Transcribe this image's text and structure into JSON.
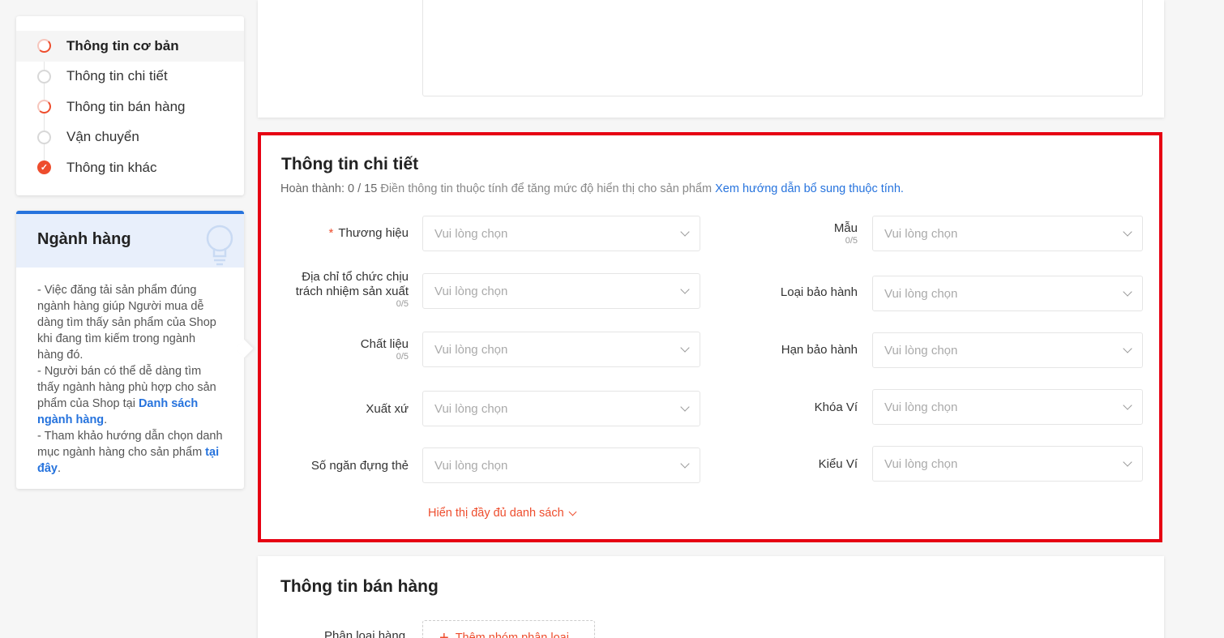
{
  "nav": {
    "items": [
      {
        "label": "Thông tin cơ bản",
        "state": "partial"
      },
      {
        "label": "Thông tin chi tiết",
        "state": "empty"
      },
      {
        "label": "Thông tin bán hàng",
        "state": "partial"
      },
      {
        "label": "Vận chuyển",
        "state": "empty"
      },
      {
        "label": "Thông tin khác",
        "state": "done"
      }
    ]
  },
  "tip": {
    "title": "Ngành hàng",
    "p1": "- Việc đăng tải sản phẩm đúng ngành hàng giúp Người mua dễ dàng tìm thấy sản phẩm của Shop khi đang tìm kiếm trong ngành hàng đó.",
    "p2_pre": "- Người bán có thể dễ dàng tìm thấy ngành hàng phù hợp cho sản phẩm của Shop tại ",
    "p2_link": "Danh sách ngành hàng",
    "p2_post": ".",
    "p3_pre": "- Tham khảo hướng dẫn chọn danh mục ngành hàng cho sản phẩm ",
    "p3_link": "tại đây",
    "p3_post": "."
  },
  "detail": {
    "title": "Thông tin chi tiết",
    "progress_label": "Hoàn thành: 0 / 15",
    "progress_hint": "Điền thông tin thuộc tính để tăng mức độ hiển thị cho sản phẩm",
    "progress_link": "Xem hướng dẫn bổ sung thuộc tính.",
    "placeholder": "Vui lòng chọn",
    "fields_left": [
      {
        "label": "Thương hiệu",
        "required": true,
        "counter": ""
      },
      {
        "label": "Địa chỉ tổ chức chịu trách nhiệm sản xuất",
        "required": false,
        "counter": "0/5"
      },
      {
        "label": "Chất liệu",
        "required": false,
        "counter": "0/5"
      },
      {
        "label": "Xuất xứ",
        "required": false,
        "counter": ""
      },
      {
        "label": "Số ngăn đựng thẻ",
        "required": false,
        "counter": ""
      }
    ],
    "fields_right": [
      {
        "label": "Mẫu",
        "counter": "0/5"
      },
      {
        "label": "Loại bảo hành",
        "counter": ""
      },
      {
        "label": "Hạn bảo hành",
        "counter": ""
      },
      {
        "label": "Khóa Ví",
        "counter": ""
      },
      {
        "label": "Kiểu Ví",
        "counter": ""
      }
    ],
    "show_all": "Hiển thị đầy đủ danh sách",
    "required_mark": "*"
  },
  "sales": {
    "title": "Thông tin bán hàng",
    "variation_label": "Phân loại hàng",
    "add_group": "Thêm nhóm phân loại"
  },
  "colors": {
    "accent": "#ee4d2d",
    "link": "#2673dd",
    "highlight_border": "#e60012"
  }
}
